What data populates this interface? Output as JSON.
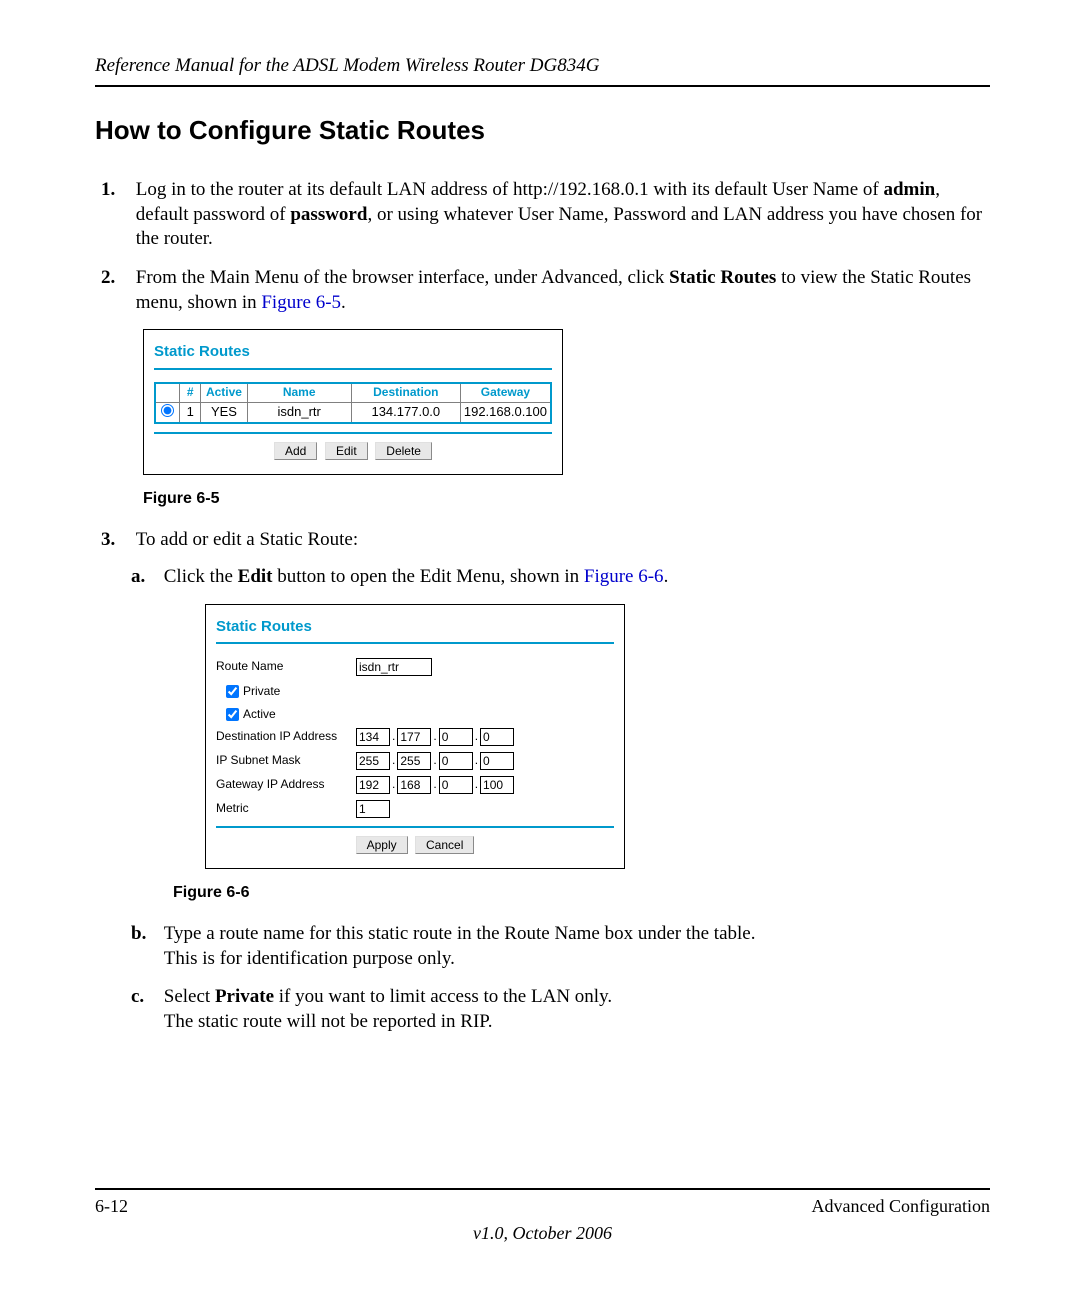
{
  "header": {
    "running_title": "Reference Manual for the ADSL Modem Wireless Router DG834G"
  },
  "section_title": "How to Configure Static Routes",
  "steps": {
    "s1_pre": "Log in to the router at its default LAN address of http://192.168.0.1 with its default User Name of ",
    "s1_admin": "admin",
    "s1_mid": ", default password of ",
    "s1_password": "password",
    "s1_post": ", or using whatever User Name, Password and LAN address you have chosen for the router.",
    "s2_pre": "From the Main Menu of the browser interface, under Advanced, click ",
    "s2_sr": "Static Routes",
    "s2_mid": " to view the Static Routes menu, shown in ",
    "s2_fig": "Figure 6-5",
    "s2_end": ".",
    "s3": "To add or edit a Static Route:",
    "s3a_pre": "Click the ",
    "s3a_edit": "Edit",
    "s3a_mid": " button to open the Edit Menu, shown in ",
    "s3a_fig": "Figure 6-6",
    "s3a_end": ".",
    "s3b_line1": "Type a route name for this static route in the Route Name box under the table.",
    "s3b_line2": "This is for identification purpose only.",
    "s3c_pre": "Select ",
    "s3c_priv": "Private",
    "s3c_post": " if you want to limit access to the LAN only.",
    "s3c_line2": "The static route will not be reported in RIP."
  },
  "fig65": {
    "label": "Figure 6-5",
    "title": "Static Routes",
    "headers": {
      "num": "#",
      "active": "Active",
      "name": "Name",
      "dest": "Destination",
      "gateway": "Gateway"
    },
    "row": {
      "num": "1",
      "active": "YES",
      "name": "isdn_rtr",
      "dest": "134.177.0.0",
      "gateway": "192.168.0.100"
    },
    "btn_add": "Add",
    "btn_edit": "Edit",
    "btn_delete": "Delete"
  },
  "fig66": {
    "label": "Figure 6-6",
    "title": "Static Routes",
    "labels": {
      "route_name": "Route Name",
      "private": "Private",
      "active": "Active",
      "dest_ip": "Destination IP Address",
      "subnet": "IP Subnet Mask",
      "gateway_ip": "Gateway IP Address",
      "metric": "Metric"
    },
    "values": {
      "route_name": "isdn_rtr",
      "dest_ip": [
        "134",
        "177",
        "0",
        "0"
      ],
      "subnet": [
        "255",
        "255",
        "0",
        "0"
      ],
      "gateway": [
        "192",
        "168",
        "0",
        "100"
      ],
      "metric": "1"
    },
    "btn_apply": "Apply",
    "btn_cancel": "Cancel"
  },
  "footer": {
    "page_num": "6-12",
    "chapter": "Advanced Configuration",
    "version": "v1.0, October 2006"
  }
}
